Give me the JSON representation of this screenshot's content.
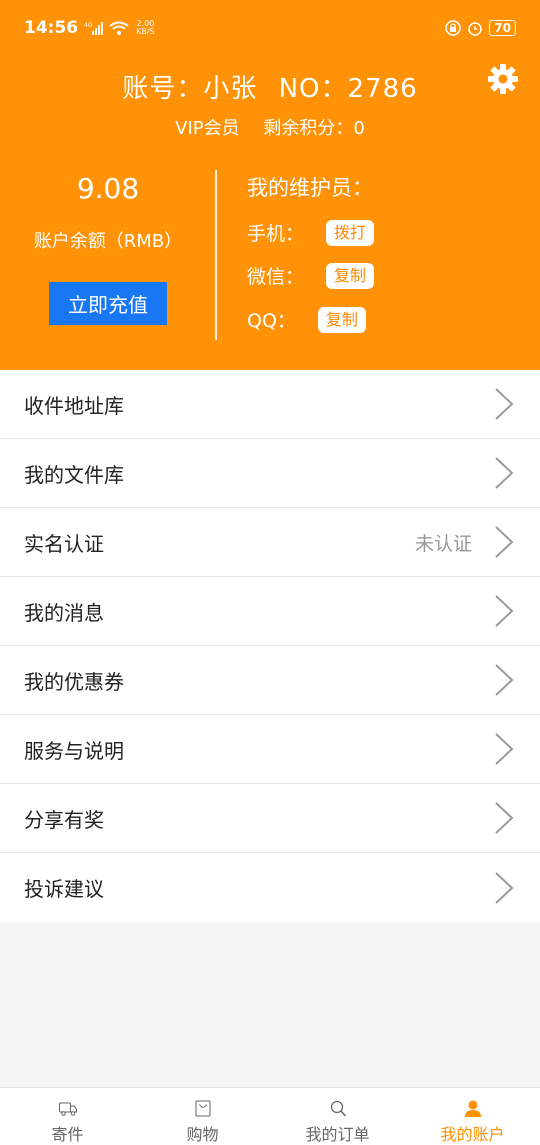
{
  "status_bar": {
    "time": "14:56",
    "network_type": "4G",
    "speed_value": "2.00",
    "speed_unit": "KB/S",
    "battery": "70"
  },
  "header": {
    "account_label": "账号：小张",
    "account_no": "NO：2786",
    "vip": "VIP会员",
    "points": "剩余积分：0",
    "balance": "9.08",
    "balance_label": "账户余额（RMB）",
    "recharge_label": "立即充值",
    "maintainer_title": "我的维护员：",
    "phone_label": "手机：",
    "phone_action": "拨打",
    "wechat_label": "微信：",
    "wechat_action": "复制",
    "qq_label": "QQ：",
    "qq_action": "复制"
  },
  "menu": {
    "items": [
      {
        "label": "收件地址库"
      },
      {
        "label": "我的文件库"
      },
      {
        "label": "实名认证",
        "status": "未认证"
      },
      {
        "label": "我的消息"
      },
      {
        "label": "我的优惠券"
      },
      {
        "label": "服务与说明"
      },
      {
        "label": "分享有奖"
      },
      {
        "label": "投诉建议"
      }
    ]
  },
  "tabbar": {
    "tabs": [
      {
        "label": "寄件",
        "icon": "truck-icon"
      },
      {
        "label": "购物",
        "icon": "bag-icon"
      },
      {
        "label": "我的订单",
        "icon": "search-icon"
      },
      {
        "label": "我的账户",
        "icon": "person-icon",
        "active": true
      }
    ]
  },
  "colors": {
    "brand_orange": "#ff9206",
    "recharge_blue": "#1877f2"
  }
}
